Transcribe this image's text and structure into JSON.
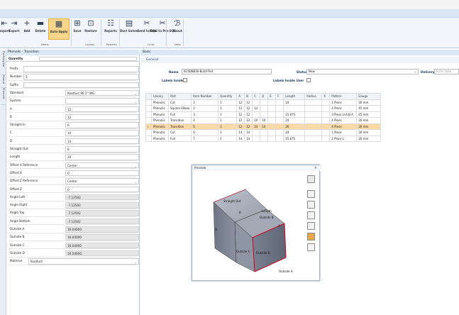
{
  "ribbon": {
    "buttons": [
      {
        "label": "Import",
        "icon": "import-icon"
      },
      {
        "label": "Export",
        "icon": "export-icon"
      },
      {
        "label": "Add",
        "icon": "add-icon"
      },
      {
        "label": "Delete",
        "icon": "delete-icon"
      },
      {
        "label": "Auto Apply",
        "icon": "auto-apply-icon"
      },
      {
        "label": "Save",
        "icon": "save-layout-icon"
      },
      {
        "label": "Restore",
        "icon": "restore-icon"
      },
      {
        "label": "Reports",
        "icon": "reports-icon"
      },
      {
        "label": "Duct Solver",
        "icon": "duct-solver-icon"
      },
      {
        "label": "Send to SQL",
        "icon": "send-sql-icon"
      },
      {
        "label": "Send to Pre-SQL",
        "icon": "send-presql-icon"
      },
      {
        "label": "About",
        "icon": "about-icon"
      }
    ],
    "groups": [
      "Items",
      "Layout",
      "Reports",
      "Links",
      "Help"
    ]
  },
  "left_panel": {
    "header": "Phenolic - Transition",
    "quantity_label": "Quantity",
    "rows": [
      {
        "label": "Prefix",
        "value": ""
      },
      {
        "label": "Number",
        "value": "5"
      },
      {
        "label": "Suffix",
        "value": ""
      },
      {
        "label": "Standard",
        "value": "Kooltuct 96 2\" WG",
        "dropdown": true
      },
      {
        "label": "System",
        "value": "",
        "dropdown": true
      },
      {
        "label": "A",
        "value": "12"
      },
      {
        "label": "B",
        "value": "12"
      },
      {
        "label": "Straight In",
        "value": "6"
      },
      {
        "label": "C",
        "value": "14"
      },
      {
        "label": "D",
        "value": "14"
      },
      {
        "label": "Straight Out",
        "value": "6"
      },
      {
        "label": "Length",
        "value": "20"
      },
      {
        "label": "Offset X Reference",
        "value": "Center",
        "dropdown": true
      },
      {
        "label": "Offset X",
        "value": "0"
      },
      {
        "label": "Offset Z Reference",
        "value": "Center",
        "dropdown": true
      },
      {
        "label": "Offset Z",
        "value": "0"
      },
      {
        "label": "Angle Left",
        "value": "-7.12502",
        "readonly": true
      },
      {
        "label": "Angle Right",
        "value": "-7.12502",
        "readonly": true
      },
      {
        "label": "Angle Top",
        "value": "-7.12502",
        "readonly": true
      },
      {
        "label": "Angle Bottom",
        "value": "-7.12502",
        "readonly": true
      },
      {
        "label": "Outside A",
        "value": "16.04000",
        "readonly": true
      },
      {
        "label": "Outside B",
        "value": "16.04000",
        "readonly": true
      },
      {
        "label": "Outside C",
        "value": "16.04000",
        "readonly": true
      },
      {
        "label": "Outside D",
        "value": "16.04000",
        "readonly": true
      }
    ],
    "material_label": "Material",
    "material_value": "Kooltuct",
    "side_tabs": [
      "Rectangular",
      "Round",
      "Phenolic"
    ]
  },
  "right_panel": {
    "header": "Basic",
    "general_label": "General",
    "name_label": "Name",
    "name_value": "6C6D8B30-Build-Test",
    "status_label": "Status",
    "status_value": "New",
    "delivery_label": "Delivery",
    "delivery_placeholder": "Enter date",
    "labels_inside_label": "Labels Inside",
    "labels_inside_user_label": "Labels Inside User",
    "columns": [
      "Library",
      "Part",
      "Item Number",
      "Quantity",
      "A",
      "B",
      "C",
      "D",
      "E",
      "F",
      "Length",
      "Radius",
      "X",
      "Pattern",
      "Gauge"
    ],
    "rows": [
      [
        "Phenolic",
        "Cut",
        "1",
        "1",
        "12",
        "12",
        "",
        "",
        "",
        "",
        "24",
        "",
        "",
        "1 Piece",
        "30 mm"
      ],
      [
        "Phenolic",
        "Square Elbow",
        "2",
        "1",
        "12",
        "12",
        "12",
        "",
        "",
        "",
        "",
        "",
        "",
        "4 Piece",
        "45 mm"
      ],
      [
        "Phenolic",
        "Full",
        "3",
        "1",
        "12",
        "12",
        "",
        "",
        "",
        "",
        "15.675",
        "",
        "",
        "3 Piece U-A-B-A",
        "45 mm"
      ],
      [
        "Phenolic",
        "Transition",
        "4",
        "1",
        "12",
        "12",
        "10",
        "10",
        "",
        "",
        "24",
        "",
        "",
        "4 Piece",
        "30 mm"
      ],
      [
        "Phenolic",
        "Transition",
        "5",
        "1",
        "12",
        "12",
        "14",
        "14",
        "",
        "",
        "20",
        "",
        "",
        "4 Piece",
        "30 mm"
      ],
      [
        "Phenolic",
        "Cut",
        "6",
        "1",
        "14",
        "14",
        "",
        "",
        "",
        "",
        "24",
        "",
        "",
        "1 Piece",
        "30 mm"
      ],
      [
        "Phenolic",
        "Full",
        "7",
        "1",
        "14",
        "14",
        "",
        "",
        "",
        "",
        "15.675",
        "",
        "",
        "2 Piece L",
        "30 mm"
      ]
    ],
    "selected_row": 4
  },
  "preview": {
    "title": "Preview",
    "labels": [
      "Straight Out",
      "Length",
      "Outside B",
      "Outside C",
      "Outside B",
      "Outside A",
      "B",
      "D",
      "A"
    ],
    "tool_icons": [
      "view-cube-icon",
      "view-iso-icon",
      "view-top-icon",
      "view-front-icon",
      "view-side-icon",
      "shade-icon",
      "wireframe-icon"
    ]
  }
}
